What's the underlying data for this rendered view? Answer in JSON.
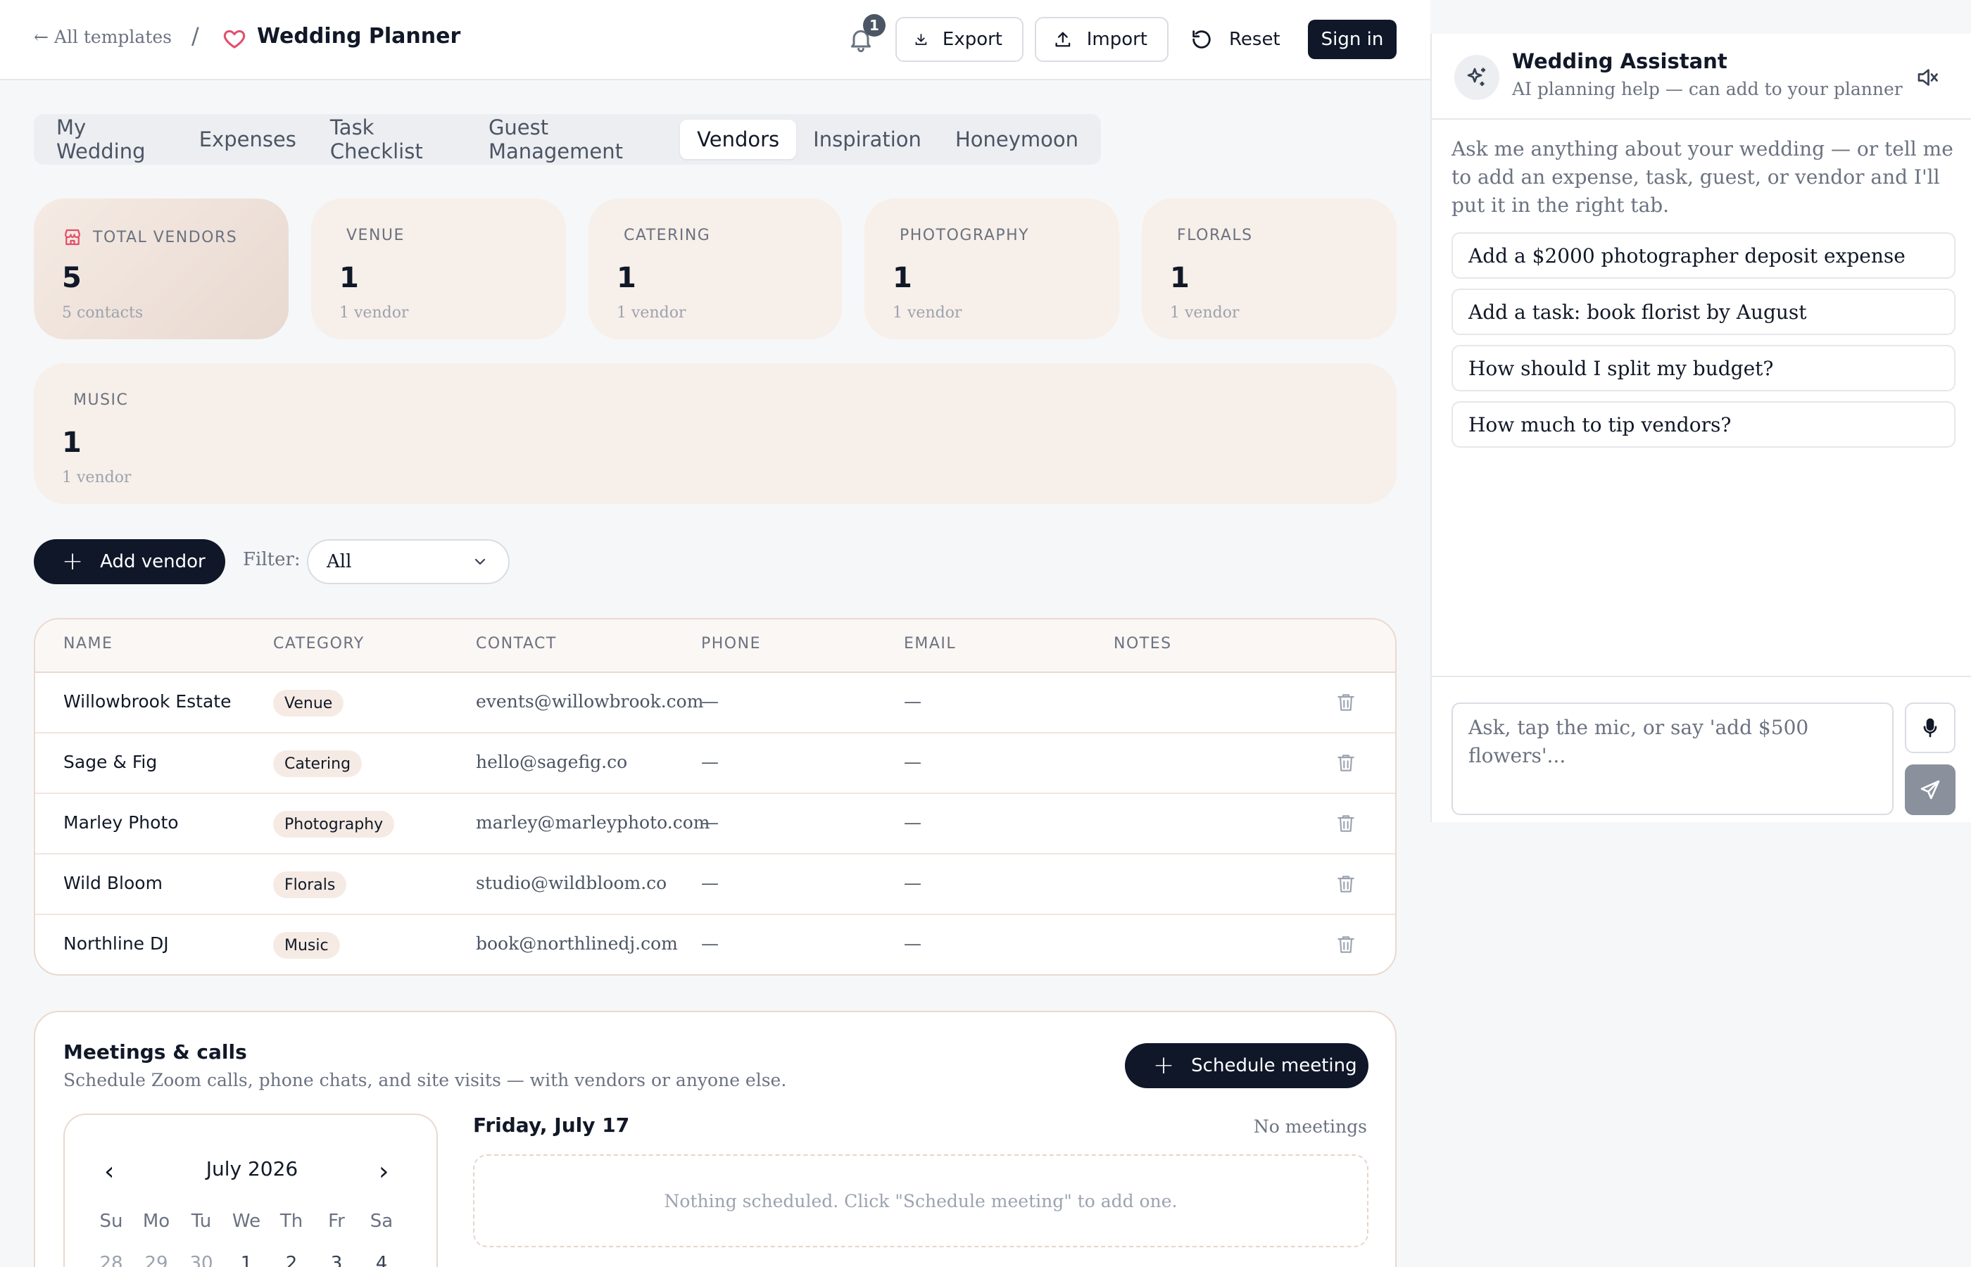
{
  "header": {
    "back_link": "← All templates",
    "separator": "/",
    "title": "Wedding Planner",
    "notifications_count": "1",
    "export_label": "Export",
    "import_label": "Import",
    "reset_label": "Reset",
    "signin_label": "Sign in"
  },
  "tabs": [
    {
      "label": "My Wedding"
    },
    {
      "label": "Expenses"
    },
    {
      "label": "Task Checklist"
    },
    {
      "label": "Guest Management"
    },
    {
      "label": "Vendors",
      "active": true
    },
    {
      "label": "Inspiration"
    },
    {
      "label": "Honeymoon"
    }
  ],
  "stats": [
    {
      "label": "TOTAL VENDORS",
      "value": "5",
      "sub": "5 contacts"
    },
    {
      "label": "VENUE",
      "value": "1",
      "sub": "1 vendor"
    },
    {
      "label": "CATERING",
      "value": "1",
      "sub": "1 vendor"
    },
    {
      "label": "PHOTOGRAPHY",
      "value": "1",
      "sub": "1 vendor"
    },
    {
      "label": "FLORALS",
      "value": "1",
      "sub": "1 vendor"
    },
    {
      "label": "MUSIC",
      "value": "1",
      "sub": "1 vendor"
    }
  ],
  "toolbar": {
    "add_label": "Add vendor",
    "filter_label": "Filter:",
    "filter_value": "All"
  },
  "table": {
    "columns": [
      "NAME",
      "CATEGORY",
      "CONTACT",
      "PHONE",
      "EMAIL",
      "NOTES"
    ],
    "rows": [
      {
        "name": "Willowbrook Estate",
        "category": "Venue",
        "contact": "events@willowbrook.com",
        "phone": "—",
        "email": "—"
      },
      {
        "name": "Sage & Fig",
        "category": "Catering",
        "contact": "hello@sagefig.co",
        "phone": "—",
        "email": "—"
      },
      {
        "name": "Marley Photo",
        "category": "Photography",
        "contact": "marley@marleyphoto.com",
        "phone": "—",
        "email": "—"
      },
      {
        "name": "Wild Bloom",
        "category": "Florals",
        "contact": "studio@wildbloom.co",
        "phone": "—",
        "email": "—"
      },
      {
        "name": "Northline DJ",
        "category": "Music",
        "contact": "book@northlinedj.com",
        "phone": "—",
        "email": "—"
      }
    ]
  },
  "meetings": {
    "title": "Meetings & calls",
    "subtitle": "Schedule Zoom calls, phone chats, and site visits — with vendors or anyone else.",
    "schedule_label": "Schedule meeting",
    "calendar": {
      "month": "July 2026",
      "weekdays": [
        "Su",
        "Mo",
        "Tu",
        "We",
        "Th",
        "Fr",
        "Sa"
      ],
      "first_row": [
        "28",
        "29",
        "30",
        "1",
        "2",
        "3",
        "4"
      ]
    },
    "selected_day": "Friday, July 17",
    "count_text": "No meetings",
    "empty_text": "Nothing scheduled. Click \"Schedule meeting\" to add one."
  },
  "assistant": {
    "title": "Wedding Assistant",
    "subtitle": "AI planning help — can add to your planner",
    "intro": "Ask me anything about your wedding — or tell me to add an expense, task, guest, or vendor and I'll put it in the right tab.",
    "suggestions": [
      "Add a $2000 photographer deposit expense",
      "Add a task: book florist by August",
      "How should I split my budget?",
      "How much to tip vendors?"
    ],
    "input_placeholder": "Ask, tap the mic, or say 'add $500 flowers'..."
  },
  "colors": {
    "primary": "#0f1729",
    "card_bg": "#f7efe9",
    "accent_heart": "#e0506a",
    "border_warm": "#ead9cf"
  }
}
